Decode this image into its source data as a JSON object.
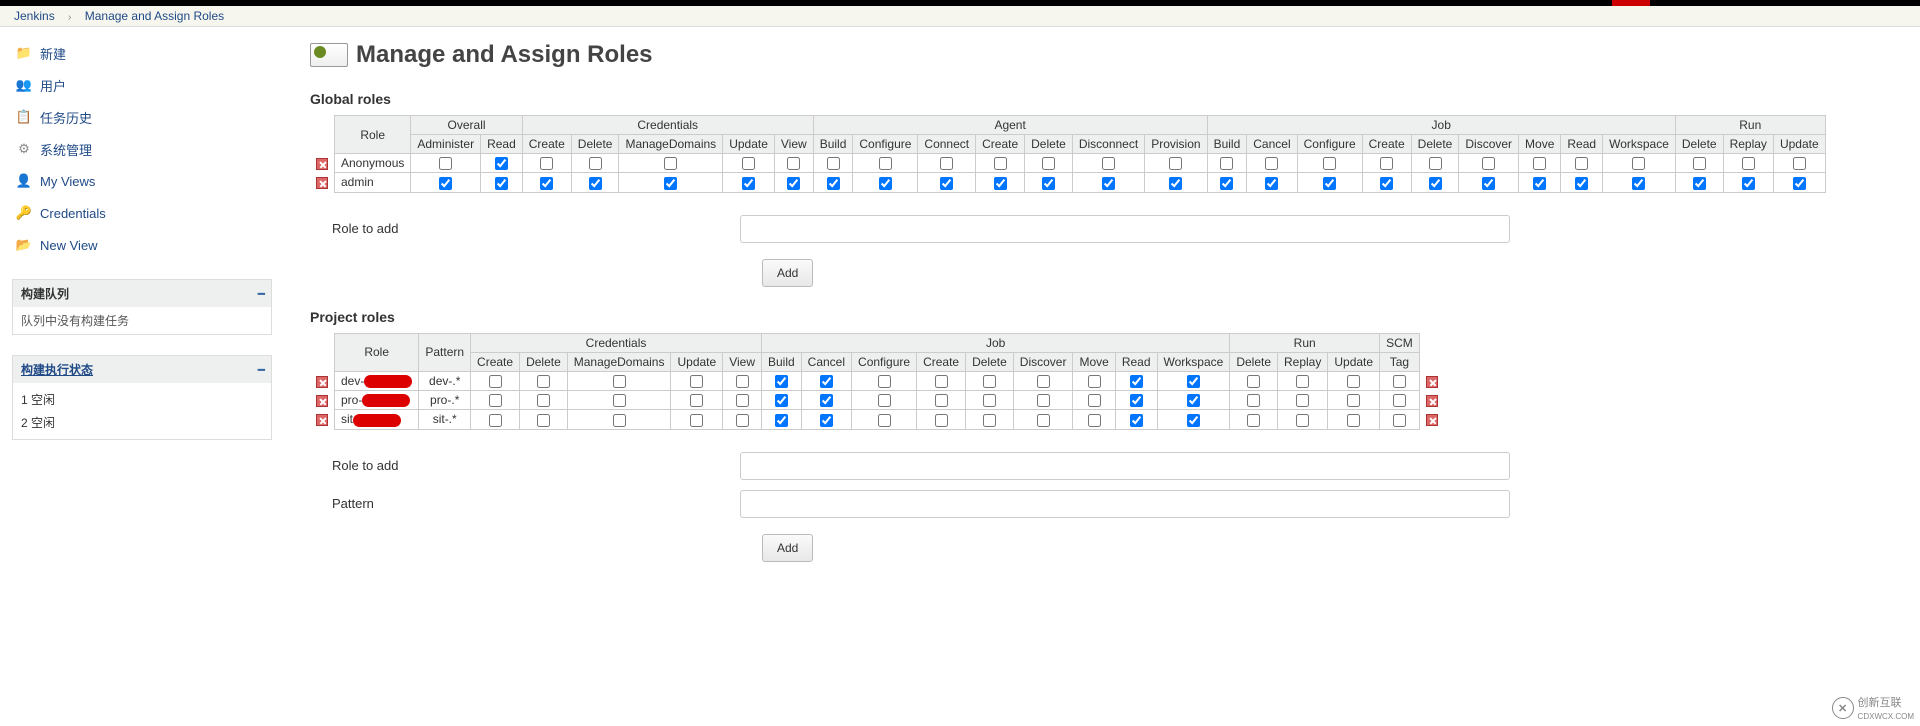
{
  "breadcrumb": {
    "root": "Jenkins",
    "page": "Manage and Assign Roles"
  },
  "sidebar": {
    "tasks": [
      {
        "label": "新建",
        "name": "new-item"
      },
      {
        "label": "用户",
        "name": "people"
      },
      {
        "label": "任务历史",
        "name": "build-history"
      },
      {
        "label": "系统管理",
        "name": "manage-jenkins"
      },
      {
        "label": "My Views",
        "name": "my-views"
      },
      {
        "label": "Credentials",
        "name": "credentials"
      },
      {
        "label": "New View",
        "name": "new-view"
      }
    ],
    "build_queue": {
      "title": "构建队列",
      "empty_msg": "队列中没有构建任务"
    },
    "executors": {
      "title": "构建执行状态",
      "rows": [
        {
          "num": "1",
          "state": "空闲"
        },
        {
          "num": "2",
          "state": "空闲"
        }
      ]
    }
  },
  "page_title": "Manage and Assign Roles",
  "global_roles": {
    "title": "Global roles",
    "role_header": "Role",
    "groups": [
      {
        "name": "Overall",
        "cols": [
          "Administer",
          "Read"
        ]
      },
      {
        "name": "Credentials",
        "cols": [
          "Create",
          "Delete",
          "ManageDomains",
          "Update",
          "View"
        ]
      },
      {
        "name": "Agent",
        "cols": [
          "Build",
          "Configure",
          "Connect",
          "Create",
          "Delete",
          "Disconnect",
          "Provision"
        ]
      },
      {
        "name": "Job",
        "cols": [
          "Build",
          "Cancel",
          "Configure",
          "Create",
          "Delete",
          "Discover",
          "Move",
          "Read",
          "Workspace"
        ]
      },
      {
        "name": "Run",
        "cols": [
          "Delete",
          "Replay",
          "Update"
        ]
      }
    ],
    "rows": [
      {
        "role": "Anonymous",
        "checked": [
          false,
          true,
          false,
          false,
          false,
          false,
          false,
          false,
          false,
          false,
          false,
          false,
          false,
          false,
          false,
          false,
          false,
          false,
          false,
          false,
          false,
          false,
          false,
          false,
          false,
          false
        ]
      },
      {
        "role": "admin",
        "checked": [
          true,
          true,
          true,
          true,
          true,
          true,
          true,
          true,
          true,
          true,
          true,
          true,
          true,
          true,
          true,
          true,
          true,
          true,
          true,
          true,
          true,
          true,
          true,
          true,
          true,
          true
        ]
      }
    ],
    "add_label": "Role to add",
    "add_btn": "Add"
  },
  "project_roles": {
    "title": "Project roles",
    "role_header": "Role",
    "pattern_header": "Pattern",
    "groups": [
      {
        "name": "Credentials",
        "cols": [
          "Create",
          "Delete",
          "ManageDomains",
          "Update",
          "View"
        ]
      },
      {
        "name": "Job",
        "cols": [
          "Build",
          "Cancel",
          "Configure",
          "Create",
          "Delete",
          "Discover",
          "Move",
          "Read",
          "Workspace"
        ]
      },
      {
        "name": "Run",
        "cols": [
          "Delete",
          "Replay",
          "Update"
        ]
      },
      {
        "name": "SCM",
        "cols": [
          "Tag"
        ]
      }
    ],
    "rows": [
      {
        "role_prefix": "dev-",
        "pattern": "dev-.*",
        "checked": [
          false,
          false,
          false,
          false,
          false,
          true,
          true,
          false,
          false,
          false,
          false,
          false,
          true,
          true,
          false,
          false,
          false,
          false
        ]
      },
      {
        "role_prefix": "pro-",
        "pattern": "pro-.*",
        "checked": [
          false,
          false,
          false,
          false,
          false,
          true,
          true,
          false,
          false,
          false,
          false,
          false,
          true,
          true,
          false,
          false,
          false,
          false
        ]
      },
      {
        "role_prefix": "sit",
        "pattern": "sit-.*",
        "checked": [
          false,
          false,
          false,
          false,
          false,
          true,
          true,
          false,
          false,
          false,
          false,
          false,
          true,
          true,
          false,
          false,
          false,
          false
        ]
      }
    ],
    "add_label": "Role to add",
    "pattern_label": "Pattern",
    "add_btn": "Add"
  },
  "watermark": {
    "brand": "创新互联",
    "sub": "CDXWCX.COM"
  }
}
